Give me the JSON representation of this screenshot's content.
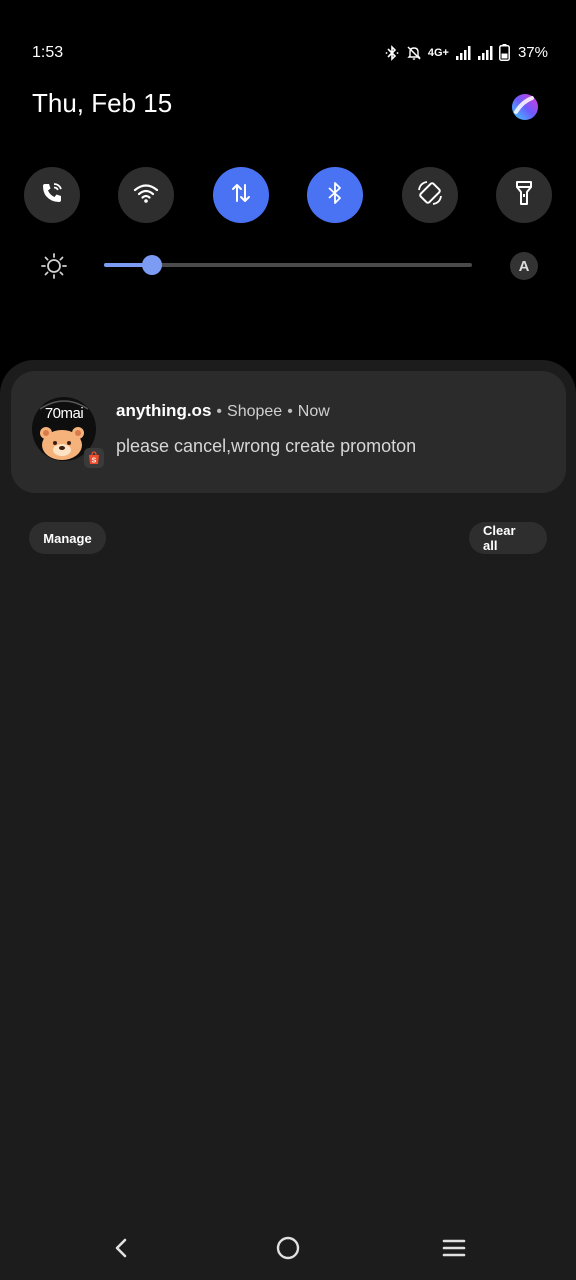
{
  "status_bar": {
    "time": "1:53",
    "network_label": "4G+",
    "battery_percent": "37%",
    "icons": [
      "bluetooth-icon",
      "bell-off-icon",
      "signal-icon",
      "signal-icon",
      "battery-icon"
    ]
  },
  "header": {
    "date": "Thu, Feb 15",
    "assistant_icon": "assistant-orb-icon"
  },
  "quick_settings": {
    "tiles": [
      {
        "icon": "wifi-calling-icon",
        "active": false
      },
      {
        "icon": "wifi-icon",
        "active": false
      },
      {
        "icon": "mobile-data-icon",
        "active": true
      },
      {
        "icon": "bluetooth-icon",
        "active": true
      },
      {
        "icon": "auto-rotate-icon",
        "active": false
      },
      {
        "icon": "flashlight-icon",
        "active": false
      }
    ],
    "brightness": {
      "level": 0.13,
      "auto_label": "A"
    }
  },
  "notification": {
    "app_title": "anything.os",
    "source": "Shopee",
    "time": "Now",
    "separator": "•",
    "message": "please cancel,wrong create promoton",
    "avatar_text": "70mai"
  },
  "actions": {
    "manage_label": "Manage",
    "clear_all_label": "Clear all"
  },
  "nav_bar": {
    "back_icon": "back-icon",
    "home_icon": "home-icon",
    "recents_icon": "recents-icon"
  },
  "colors": {
    "accent": "#4a73f4",
    "slider": "#7c9cf3",
    "panel": "#1c1c1c",
    "card": "#2b2b2b"
  }
}
